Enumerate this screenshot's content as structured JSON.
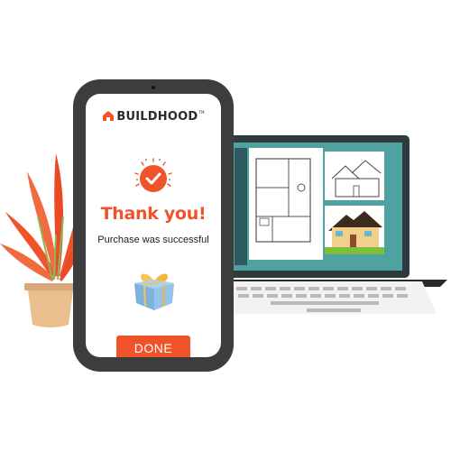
{
  "brand": {
    "name": "BUILDHOOD",
    "trademark": "TM",
    "color": "#f0522a"
  },
  "confirmation": {
    "title": "Thank you!",
    "message": "Purchase was successful",
    "done_label": "DONE",
    "icon": "check-circle-icon",
    "accent_color": "#f0522a"
  },
  "illustration": {
    "gift_icon": "gift-box-icon",
    "plant_icon": "potted-plant-icon",
    "laptop_icon": "laptop-icon",
    "floor_plan": "floor-plan-drawing",
    "house_sketch": "house-elevation-sketch",
    "house_render": "house-color-render"
  }
}
